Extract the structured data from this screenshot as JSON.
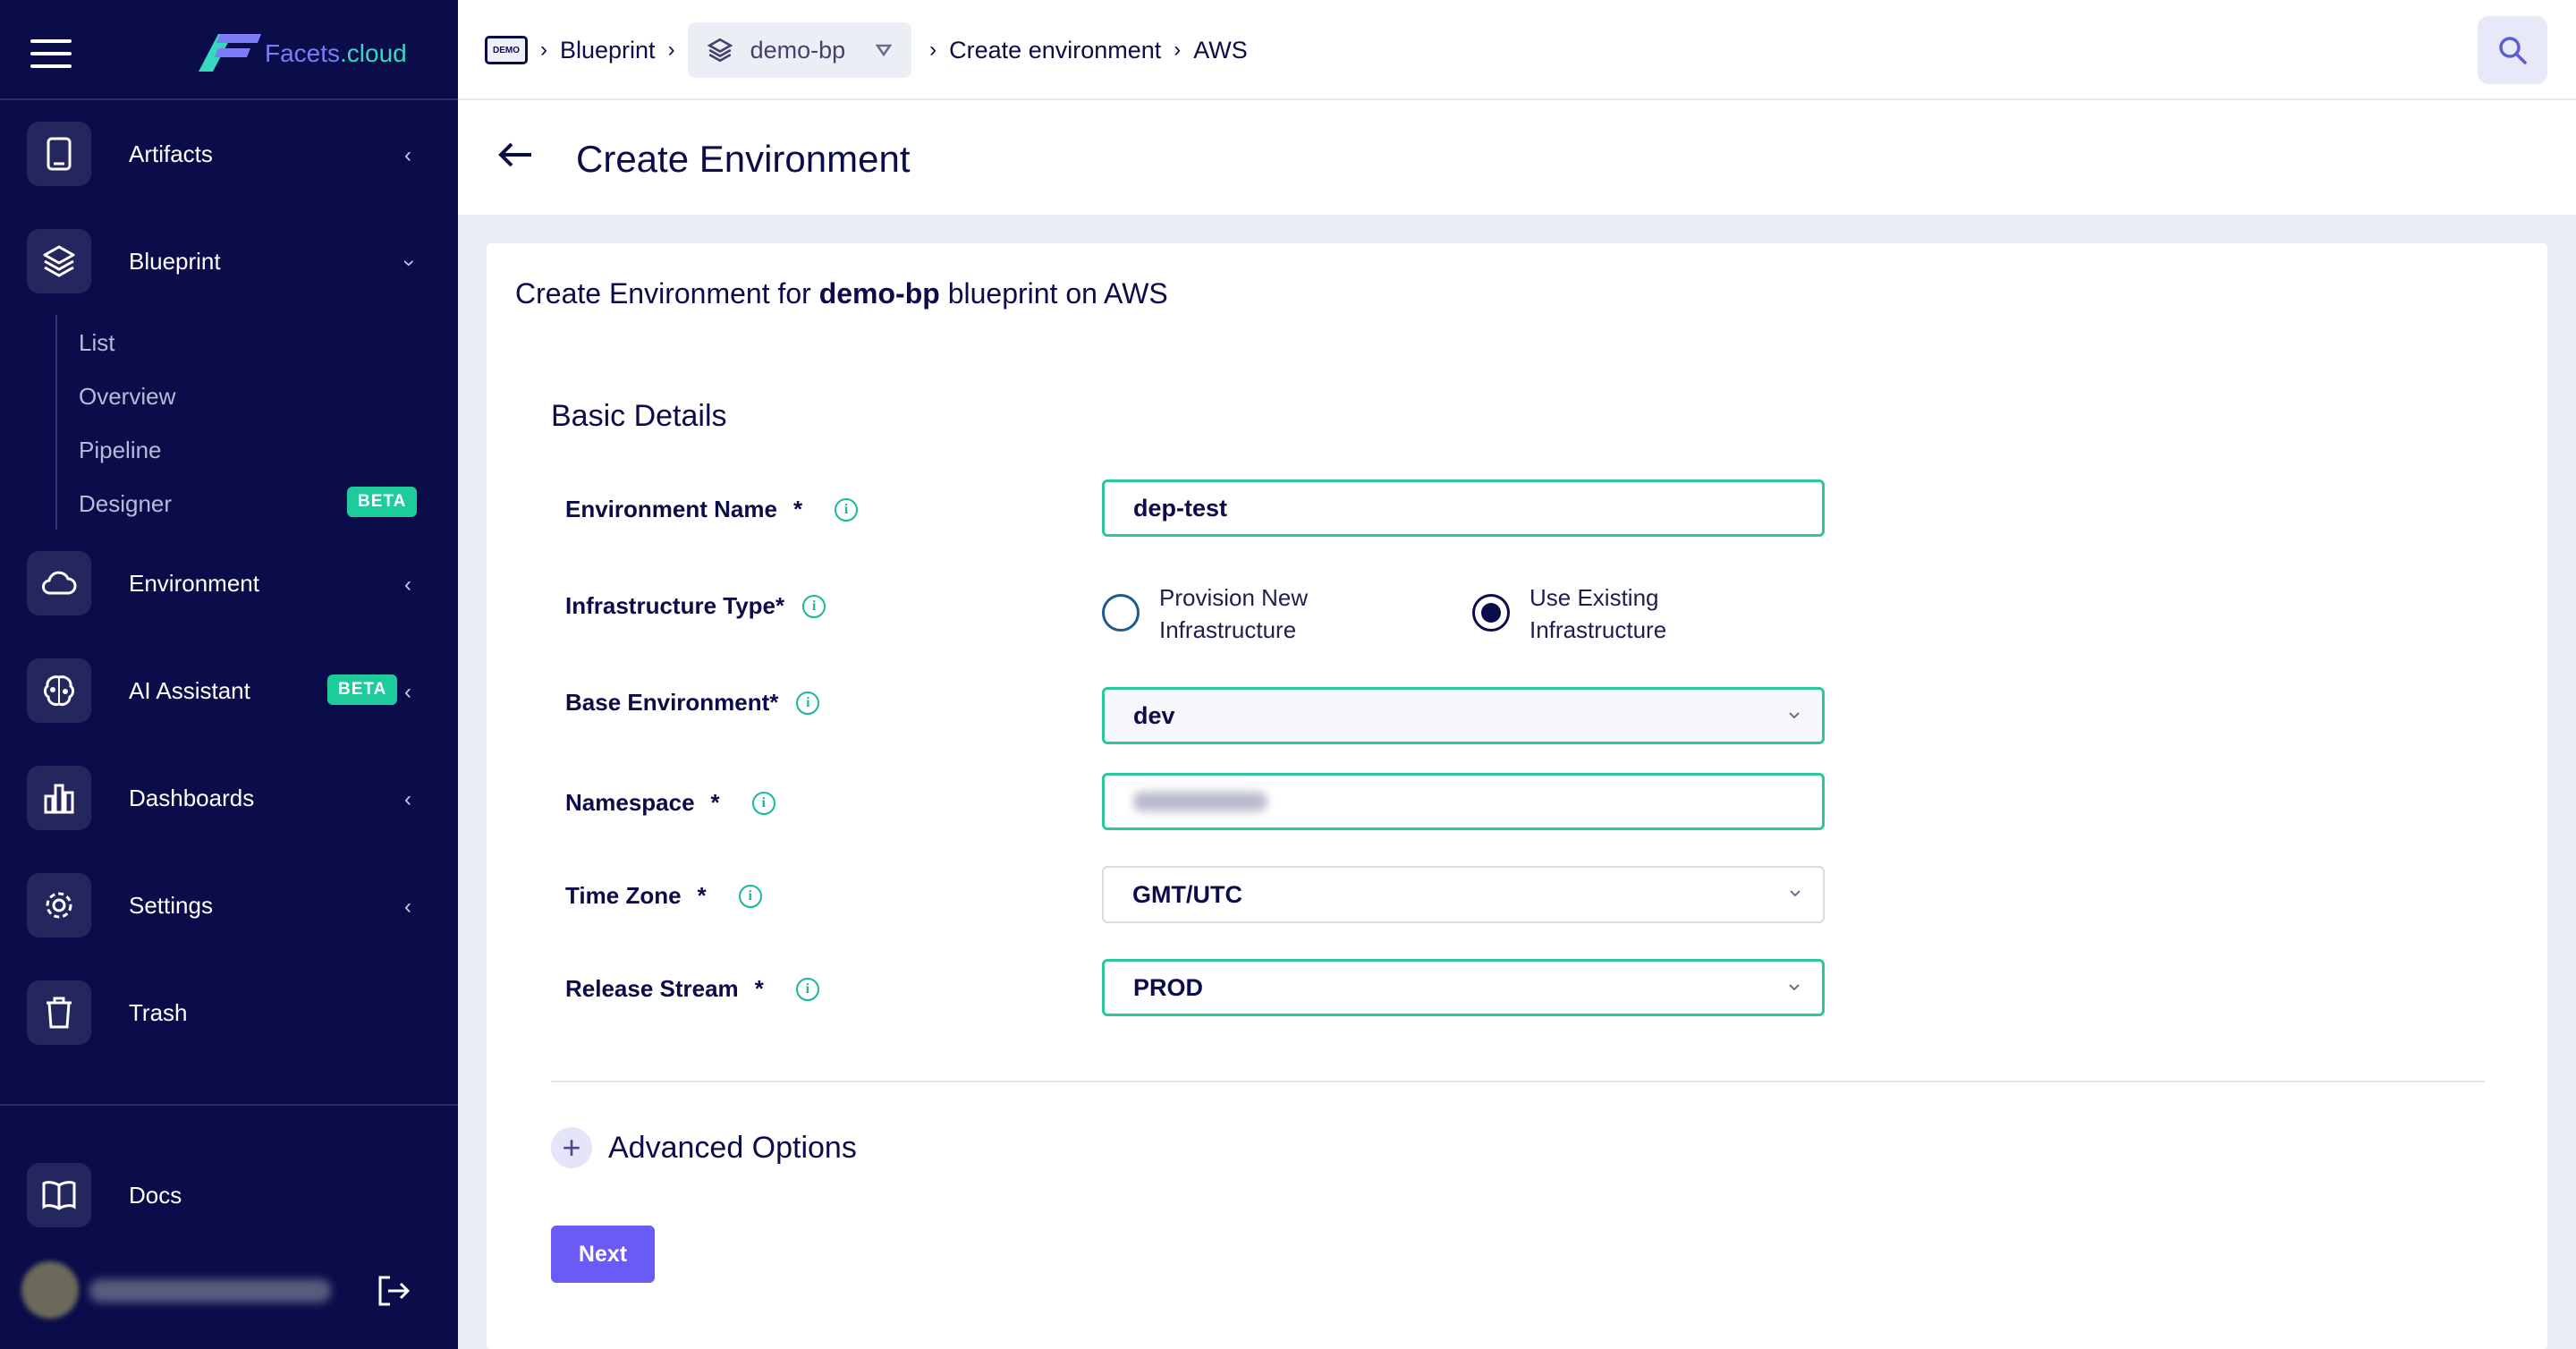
{
  "brand": {
    "name_part1": "Facets",
    "name_part2": ".cloud"
  },
  "sidebar": {
    "items": [
      {
        "label": "Artifacts",
        "icon": "tablet-icon"
      },
      {
        "label": "Blueprint",
        "icon": "layers-icon"
      },
      {
        "label": "Environment",
        "icon": "cloud-icon"
      },
      {
        "label": "AI Assistant",
        "icon": "brain-icon",
        "badge": "BETA"
      },
      {
        "label": "Dashboards",
        "icon": "bar-chart-icon"
      },
      {
        "label": "Settings",
        "icon": "gear-icon"
      },
      {
        "label": "Trash",
        "icon": "trash-icon"
      }
    ],
    "blueprint_sub": [
      {
        "label": "List"
      },
      {
        "label": "Overview"
      },
      {
        "label": "Pipeline"
      },
      {
        "label": "Designer",
        "badge": "BETA"
      }
    ],
    "docs": {
      "label": "Docs",
      "icon": "book-icon"
    }
  },
  "topbar": {
    "demo_badge": "DEMO",
    "crumbs": {
      "blueprint": "Blueprint",
      "selector": "demo-bp",
      "create": "Create environment",
      "cloud": "AWS"
    }
  },
  "page": {
    "title": "Create Environment"
  },
  "card": {
    "title_prefix": "Create Environment for ",
    "title_blueprint": "demo-bp",
    "title_suffix": " blueprint on AWS",
    "section": "Basic Details",
    "fields": {
      "env_name": {
        "label": "Environment Name",
        "required": "*",
        "value": "dep-test"
      },
      "infra_type": {
        "label": "Infrastructure Type*",
        "opt1_line1": "Provision New",
        "opt1_line2": "Infrastructure",
        "opt2_line1": "Use Existing",
        "opt2_line2": "Infrastructure",
        "selected": "Use Existing Infrastructure"
      },
      "base_env": {
        "label": "Base Environment*",
        "value": "dev"
      },
      "namespace": {
        "label": "Namespace",
        "required": "*"
      },
      "time_zone": {
        "label": "Time Zone",
        "required": "*",
        "value": "GMT/UTC"
      },
      "release_stream": {
        "label": "Release Stream",
        "required": "*",
        "value": "PROD"
      }
    },
    "advanced": "Advanced Options",
    "next": "Next"
  },
  "colors": {
    "sidebar": "#0b0c4a",
    "accent": "#6a5bf6",
    "valid": "#2cc79c",
    "beta": "#1ecb9a"
  }
}
